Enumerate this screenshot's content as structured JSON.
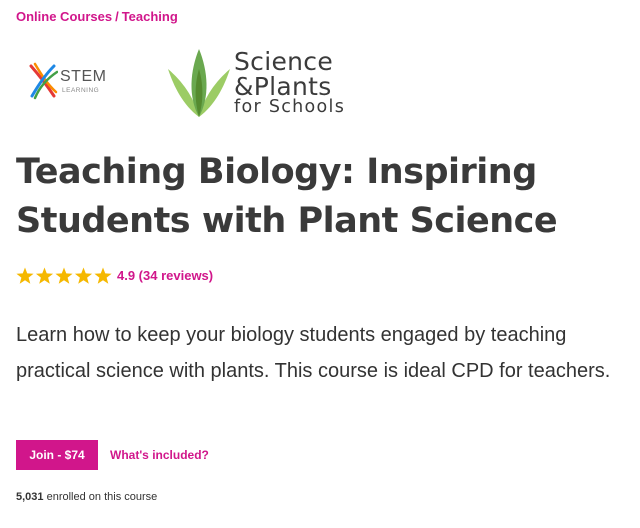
{
  "breadcrumb": {
    "items": [
      "Online Courses",
      "Teaching"
    ],
    "separator": "/"
  },
  "logos": {
    "stem": {
      "name": "STEM",
      "sub": "LEARNING",
      "icon": "stem-x-logo-icon"
    },
    "partner": {
      "line1": "Science",
      "line2": "&Plants",
      "line3": "for Schools",
      "icon": "leaf-logo-icon"
    }
  },
  "course": {
    "title": "Teaching Biology: Inspiring Students with Plant Science",
    "rating": {
      "stars": 5,
      "max_stars": 5,
      "text": "4.9 (34 reviews)"
    },
    "description": "Learn how to keep your biology students engaged by teaching practical science with plants. This course is ideal CPD for teachers.",
    "join_label": "Join - $74",
    "included_label": "What's included?",
    "enrolled_count": "5,031",
    "enrolled_suffix": "enrolled on this course"
  },
  "colors": {
    "accent": "#d1168b",
    "star": "#f5b800",
    "heading": "#3a3a3a",
    "leaf_dark": "#6aa84f",
    "leaf_light": "#9ccc65"
  }
}
